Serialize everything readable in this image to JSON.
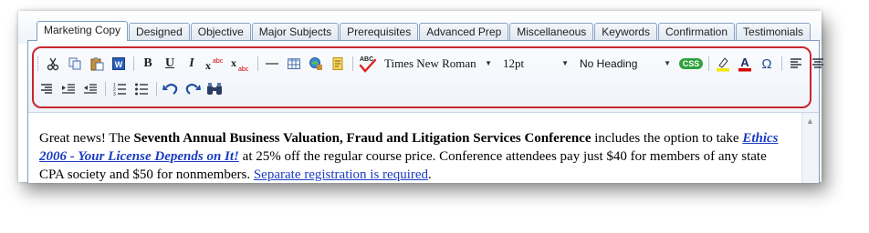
{
  "tabs": [
    {
      "label": "Marketing Copy",
      "active": true
    },
    {
      "label": "Designed"
    },
    {
      "label": "Objective"
    },
    {
      "label": "Major Subjects"
    },
    {
      "label": "Prerequisites"
    },
    {
      "label": "Advanced Prep"
    },
    {
      "label": "Miscellaneous"
    },
    {
      "label": "Keywords"
    },
    {
      "label": "Confirmation"
    },
    {
      "label": "Testimonials"
    }
  ],
  "toolbar": {
    "bold_label": "B",
    "underline_label": "U",
    "italic_label": "I",
    "spellcheck_label": "ABC",
    "font_family": "Times New Roman",
    "font_size": "12pt",
    "heading": "No Heading",
    "css_label": "CSS",
    "special_char_label": "Ω",
    "highlight_color": "#c8262e"
  },
  "content": {
    "p1_a": "Great news! The ",
    "p1_bold": "Seventh Annual Business Valuation, Fraud and Litigation Services Conference",
    "p1_b": " includes the option to take ",
    "p1_link": "Ethics 2006 - Your License Depends on It!",
    "p1_c": " at 25% off the regular course price. Conference attendees pay just $40 for members of any state CPA society and $50 for nonmembers. ",
    "p1_link2": "Separate registration is required",
    "p1_d": "."
  }
}
